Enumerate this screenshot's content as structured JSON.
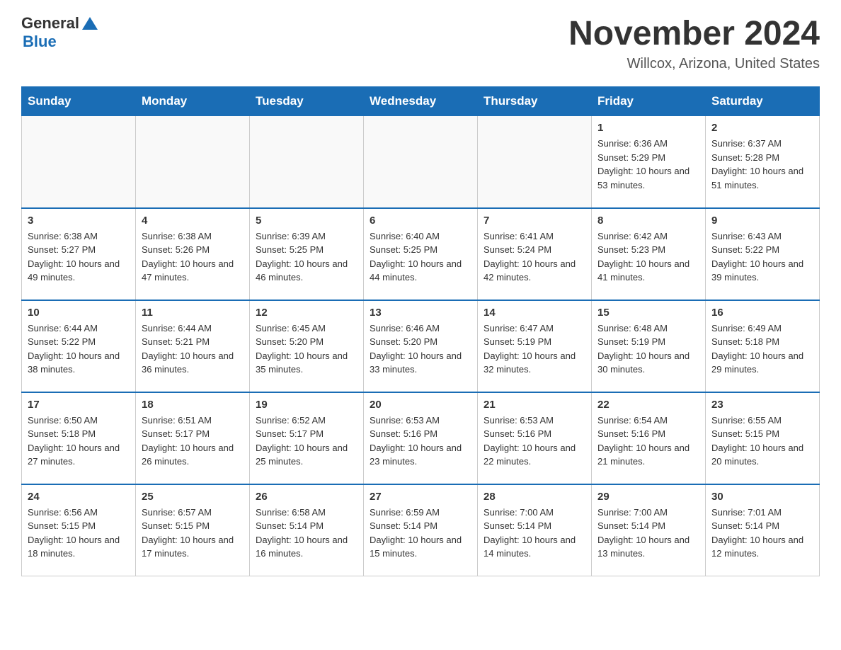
{
  "header": {
    "logo_general": "General",
    "logo_blue": "Blue",
    "title": "November 2024",
    "subtitle": "Willcox, Arizona, United States"
  },
  "days_of_week": [
    "Sunday",
    "Monday",
    "Tuesday",
    "Wednesday",
    "Thursday",
    "Friday",
    "Saturday"
  ],
  "weeks": [
    [
      {
        "day": "",
        "info": ""
      },
      {
        "day": "",
        "info": ""
      },
      {
        "day": "",
        "info": ""
      },
      {
        "day": "",
        "info": ""
      },
      {
        "day": "",
        "info": ""
      },
      {
        "day": "1",
        "info": "Sunrise: 6:36 AM\nSunset: 5:29 PM\nDaylight: 10 hours and 53 minutes."
      },
      {
        "day": "2",
        "info": "Sunrise: 6:37 AM\nSunset: 5:28 PM\nDaylight: 10 hours and 51 minutes."
      }
    ],
    [
      {
        "day": "3",
        "info": "Sunrise: 6:38 AM\nSunset: 5:27 PM\nDaylight: 10 hours and 49 minutes."
      },
      {
        "day": "4",
        "info": "Sunrise: 6:38 AM\nSunset: 5:26 PM\nDaylight: 10 hours and 47 minutes."
      },
      {
        "day": "5",
        "info": "Sunrise: 6:39 AM\nSunset: 5:25 PM\nDaylight: 10 hours and 46 minutes."
      },
      {
        "day": "6",
        "info": "Sunrise: 6:40 AM\nSunset: 5:25 PM\nDaylight: 10 hours and 44 minutes."
      },
      {
        "day": "7",
        "info": "Sunrise: 6:41 AM\nSunset: 5:24 PM\nDaylight: 10 hours and 42 minutes."
      },
      {
        "day": "8",
        "info": "Sunrise: 6:42 AM\nSunset: 5:23 PM\nDaylight: 10 hours and 41 minutes."
      },
      {
        "day": "9",
        "info": "Sunrise: 6:43 AM\nSunset: 5:22 PM\nDaylight: 10 hours and 39 minutes."
      }
    ],
    [
      {
        "day": "10",
        "info": "Sunrise: 6:44 AM\nSunset: 5:22 PM\nDaylight: 10 hours and 38 minutes."
      },
      {
        "day": "11",
        "info": "Sunrise: 6:44 AM\nSunset: 5:21 PM\nDaylight: 10 hours and 36 minutes."
      },
      {
        "day": "12",
        "info": "Sunrise: 6:45 AM\nSunset: 5:20 PM\nDaylight: 10 hours and 35 minutes."
      },
      {
        "day": "13",
        "info": "Sunrise: 6:46 AM\nSunset: 5:20 PM\nDaylight: 10 hours and 33 minutes."
      },
      {
        "day": "14",
        "info": "Sunrise: 6:47 AM\nSunset: 5:19 PM\nDaylight: 10 hours and 32 minutes."
      },
      {
        "day": "15",
        "info": "Sunrise: 6:48 AM\nSunset: 5:19 PM\nDaylight: 10 hours and 30 minutes."
      },
      {
        "day": "16",
        "info": "Sunrise: 6:49 AM\nSunset: 5:18 PM\nDaylight: 10 hours and 29 minutes."
      }
    ],
    [
      {
        "day": "17",
        "info": "Sunrise: 6:50 AM\nSunset: 5:18 PM\nDaylight: 10 hours and 27 minutes."
      },
      {
        "day": "18",
        "info": "Sunrise: 6:51 AM\nSunset: 5:17 PM\nDaylight: 10 hours and 26 minutes."
      },
      {
        "day": "19",
        "info": "Sunrise: 6:52 AM\nSunset: 5:17 PM\nDaylight: 10 hours and 25 minutes."
      },
      {
        "day": "20",
        "info": "Sunrise: 6:53 AM\nSunset: 5:16 PM\nDaylight: 10 hours and 23 minutes."
      },
      {
        "day": "21",
        "info": "Sunrise: 6:53 AM\nSunset: 5:16 PM\nDaylight: 10 hours and 22 minutes."
      },
      {
        "day": "22",
        "info": "Sunrise: 6:54 AM\nSunset: 5:16 PM\nDaylight: 10 hours and 21 minutes."
      },
      {
        "day": "23",
        "info": "Sunrise: 6:55 AM\nSunset: 5:15 PM\nDaylight: 10 hours and 20 minutes."
      }
    ],
    [
      {
        "day": "24",
        "info": "Sunrise: 6:56 AM\nSunset: 5:15 PM\nDaylight: 10 hours and 18 minutes."
      },
      {
        "day": "25",
        "info": "Sunrise: 6:57 AM\nSunset: 5:15 PM\nDaylight: 10 hours and 17 minutes."
      },
      {
        "day": "26",
        "info": "Sunrise: 6:58 AM\nSunset: 5:14 PM\nDaylight: 10 hours and 16 minutes."
      },
      {
        "day": "27",
        "info": "Sunrise: 6:59 AM\nSunset: 5:14 PM\nDaylight: 10 hours and 15 minutes."
      },
      {
        "day": "28",
        "info": "Sunrise: 7:00 AM\nSunset: 5:14 PM\nDaylight: 10 hours and 14 minutes."
      },
      {
        "day": "29",
        "info": "Sunrise: 7:00 AM\nSunset: 5:14 PM\nDaylight: 10 hours and 13 minutes."
      },
      {
        "day": "30",
        "info": "Sunrise: 7:01 AM\nSunset: 5:14 PM\nDaylight: 10 hours and 12 minutes."
      }
    ]
  ]
}
